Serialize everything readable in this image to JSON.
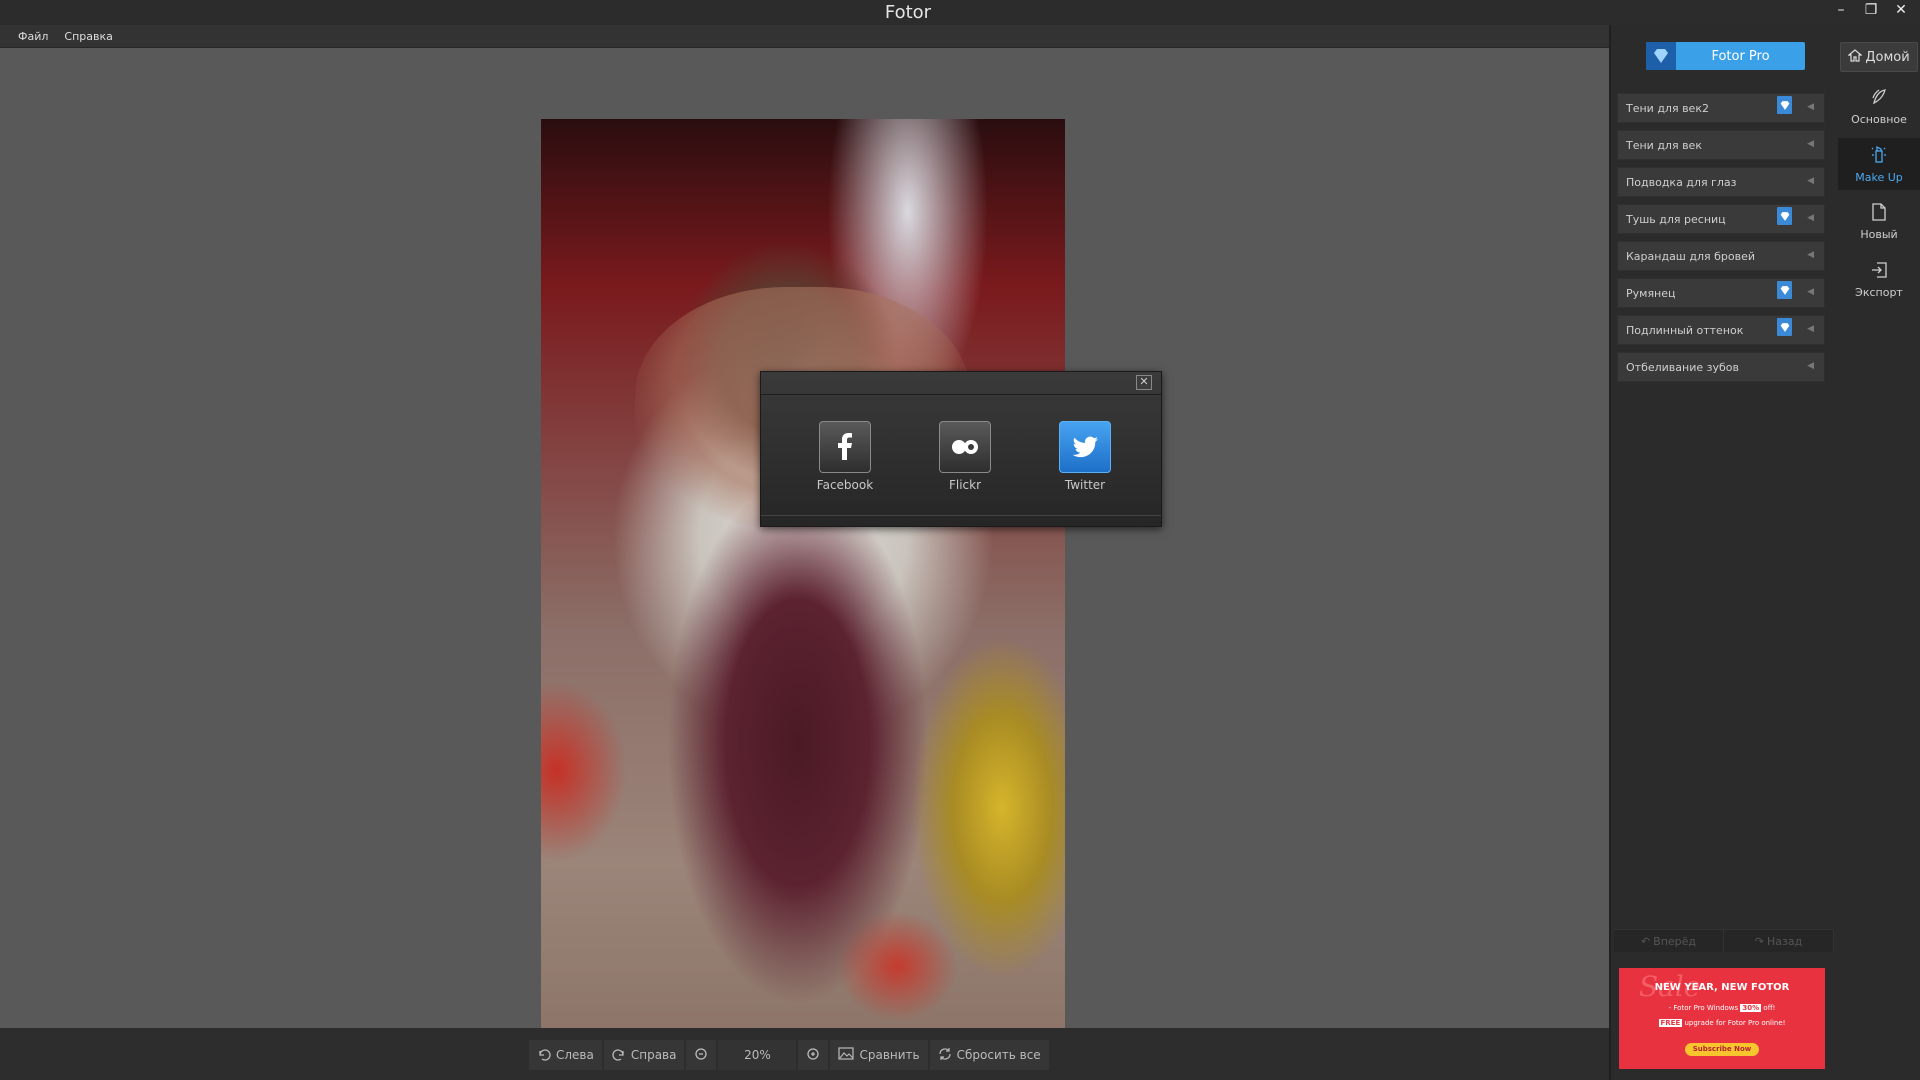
{
  "window": {
    "title": "Fotor",
    "controls": {
      "minimize": "–",
      "restore": "❐",
      "close": "✕"
    }
  },
  "menu": [
    "Файл",
    "Справка"
  ],
  "share_dialog": {
    "close": "✕",
    "items": [
      {
        "label": "Facebook",
        "icon": "facebook-icon"
      },
      {
        "label": "Flickr",
        "icon": "flickr-icon"
      },
      {
        "label": "Twitter",
        "icon": "twitter-icon"
      }
    ]
  },
  "header": {
    "pro_label": "Fotor Pro",
    "home_label": "Домой"
  },
  "tools": [
    {
      "label": "Тени для век2",
      "pro": true
    },
    {
      "label": "Тени для век",
      "pro": false
    },
    {
      "label": "Подводка для глаз",
      "pro": false
    },
    {
      "label": "Тушь для ресниц",
      "pro": true
    },
    {
      "label": "Карандаш для бровей",
      "pro": false
    },
    {
      "label": "Румянец",
      "pro": true
    },
    {
      "label": "Подлинный оттенок",
      "pro": true
    },
    {
      "label": "Отбеливание зубов",
      "pro": false
    }
  ],
  "side_nav": [
    {
      "label": "Основное",
      "icon": "basic-icon",
      "active": false
    },
    {
      "label": "Make Up",
      "icon": "makeup-icon",
      "active": true
    },
    {
      "label": "Новый",
      "icon": "new-file-icon",
      "active": false
    },
    {
      "label": "Экспорт",
      "icon": "export-icon",
      "active": false
    }
  ],
  "history": {
    "forward": "Вперёд",
    "back": "Назад"
  },
  "promo": {
    "title": "NEW YEAR, NEW FOTOR",
    "line1_prefix": "- Fotor Pro Windows",
    "line1_badge": "30%",
    "line1_suffix": "off!",
    "line2_badge": "FREE",
    "line2_text": "upgrade for Fotor Pro online!",
    "cta": "Subscribe Now"
  },
  "bottom_bar": {
    "rotate_left": "Слева",
    "rotate_right": "Справа",
    "zoom": "20%",
    "compare": "Сравнить",
    "reset": "Сбросить все"
  },
  "colors": {
    "accent": "#3aa0e8",
    "panel": "#2b2b2b",
    "canvas": "#595959",
    "active_nav_text": "#4aa8f0"
  }
}
